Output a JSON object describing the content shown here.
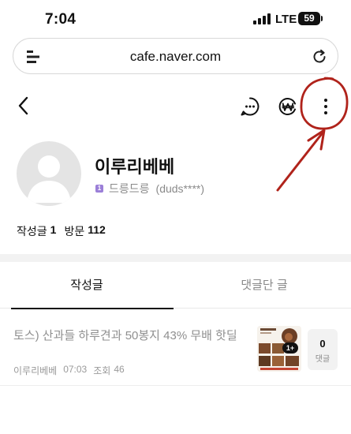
{
  "status_bar": {
    "time": "7:04",
    "network": "LTE",
    "battery": "59"
  },
  "browser": {
    "url": "cafe.naver.com"
  },
  "toolbar": {
    "back_icon": "chevron-left-icon",
    "chat_icon": "chat-bubble-icon",
    "won_icon": "won-currency-icon",
    "more_icon": "more-vertical-icon",
    "annotation_color": "#b0231b"
  },
  "profile": {
    "nickname": "이루리베베",
    "rank_badge": "1",
    "rank_name": "드릉드릉",
    "user_id": "(duds****)",
    "posts_label": "작성글",
    "posts_count": "1",
    "visits_label": "방문",
    "visits_count": "112"
  },
  "tabs": [
    {
      "label": "작성글",
      "active": true
    },
    {
      "label": "댓글단 글",
      "active": false
    }
  ],
  "posts": [
    {
      "title": "토스) 산과들 하루견과 50봉지 43% 무배 핫딜",
      "author": "이루리베베",
      "time": "07:03",
      "views_label": "조회",
      "views": "46",
      "thumb_badge": "1+",
      "comment_count": "0",
      "comment_label": "댓글"
    }
  ],
  "colors": {
    "accent_dark": "#111111",
    "muted": "#8f8f8f",
    "rank_badge": "#9b7fd8"
  }
}
